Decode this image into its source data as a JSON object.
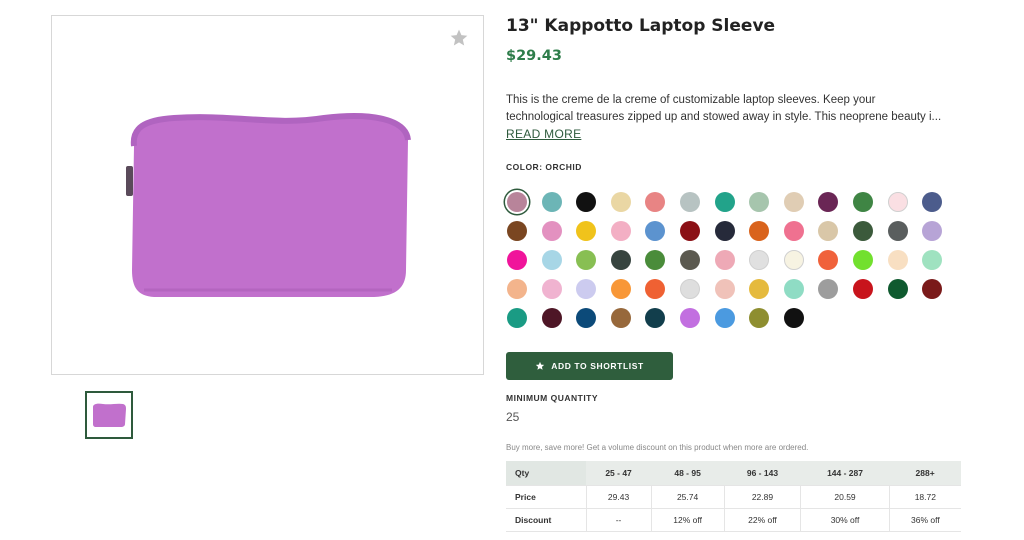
{
  "product": {
    "title": "13\" Kappotto Laptop Sleeve",
    "price": "$29.43",
    "description_line1": "This is the creme de la creme of customizable laptop sleeves. Keep your",
    "description_line2": "technological treasures zipped up and stowed away in style. This neoprene beauty i...",
    "read_more": "READ MORE",
    "color_label": "COLOR: ORCHID",
    "main_image_color": "#c97ad4",
    "add_to_shortlist": "ADD TO SHORTLIST",
    "minimum_quantity_label": "MINIMUM QUANTITY",
    "minimum_quantity_value": "25",
    "bulk_note": "Buy more, save more! Get a volume discount on this product when more are ordered."
  },
  "swatches": [
    "#b8849a",
    "#6cb5b6",
    "#111111",
    "#ead7a4",
    "#e88484",
    "#b7c3c2",
    "#22a38a",
    "#a6c5ad",
    "#e0cdb4",
    "#6a2655",
    "#3f8544",
    "#fadfe3",
    "#4c5c8c",
    "#7a4621",
    "#e391c0",
    "#f0c31b",
    "#f3afc4",
    "#5c93cf",
    "#8b1015",
    "#262a3a",
    "#d9631c",
    "#ef7190",
    "#d9c7a8",
    "#3b5a3b",
    "#5a5e5e",
    "#b7a4d6",
    "#f0149b",
    "#a7d6e6",
    "#88bf53",
    "#37443f",
    "#4a8c3a",
    "#5c5a50",
    "#eea9b6",
    "#e0e0e0",
    "#f7f3e2",
    "#f0623b",
    "#72e02e",
    "#f8dfc2",
    "#9fe2c0",
    "#f3b48c",
    "#f0b3d0",
    "#cccbef",
    "#f89737",
    "#ef6133",
    "#dedede",
    "#f0c2b9",
    "#e5ba3e",
    "#8fdcc4",
    "#9d9d9d",
    "#c8141c",
    "#0f5a2f",
    "#7a1a1a",
    "#1a9b84",
    "#4e1626",
    "#0c4a79",
    "#97683b",
    "#123e4c",
    "#c26fe0",
    "#4b9ae0",
    "#8e8e30",
    "#111111"
  ],
  "selected_swatch_index": 0,
  "price_table": {
    "headers": [
      "Qty",
      "25 - 47",
      "48 - 95",
      "96 - 143",
      "144 - 287",
      "288+"
    ],
    "rows": [
      [
        "Price",
        "29.43",
        "25.74",
        "22.89",
        "20.59",
        "18.72"
      ],
      [
        "Discount",
        "--",
        "12% off",
        "22% off",
        "30% off",
        "36% off"
      ]
    ]
  },
  "icons": {
    "favorite": "star-icon",
    "shortlist": "star-icon"
  }
}
